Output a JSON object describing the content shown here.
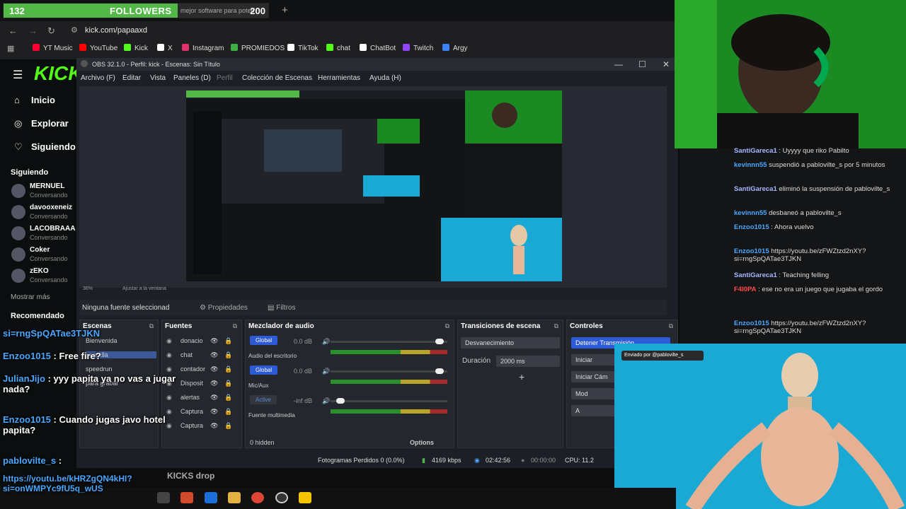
{
  "overlay": {
    "followers_count": "132",
    "followers_label": "FOLLOWERS",
    "followers_total": "200",
    "tab_text": "mejor software para poten"
  },
  "browser": {
    "url": "kick.com/papaaxd",
    "bookmarks": [
      {
        "label": "YT Music",
        "color": "#ff0033"
      },
      {
        "label": "YouTube",
        "color": "#ff0000"
      },
      {
        "label": "Kick",
        "color": "#53fc18"
      },
      {
        "label": "X",
        "color": "#ffffff"
      },
      {
        "label": "Instagram",
        "color": "#e1306c"
      },
      {
        "label": "PROMIEDOS",
        "color": "#3cb043"
      },
      {
        "label": "TikTok",
        "color": "#ffffff"
      },
      {
        "label": "chat",
        "color": "#53fc18"
      },
      {
        "label": "ChatBot",
        "color": "#ffffff"
      },
      {
        "label": "Twitch",
        "color": "#9146ff"
      },
      {
        "label": "Argy",
        "color": "#3b82f6"
      }
    ]
  },
  "kick": {
    "logo": "KICK",
    "nav": [
      "Inicio",
      "Explorar",
      "Siguiendo"
    ],
    "following_title": "Siguiendo",
    "following": [
      {
        "name": "MERNUEL",
        "status": "Conversando"
      },
      {
        "name": "davooxeneiz",
        "status": "Conversando"
      },
      {
        "name": "LACOBRAAA",
        "status": "Conversando"
      },
      {
        "name": "Coker",
        "status": "Conversando"
      },
      {
        "name": "zEKO",
        "status": "Conversando"
      }
    ],
    "show_more": "Mostrar más",
    "recommended_title": "Recomendado",
    "kicks_drop": "KICKS drop"
  },
  "obs": {
    "title": "OBS 32.1.0 - Perfil: kick - Escenas: Sin Título",
    "menu": [
      "Archivo (F)",
      "Editar",
      "Vista",
      "Paneles (D)",
      "Perfil",
      "Colección de Escenas",
      "Herramientas",
      "Ayuda (H)"
    ],
    "zoom": "36%",
    "zoom_label": "Ajustar a la ventana",
    "no_source": "Ninguna fuente seleccionad",
    "properties": "Propiedades",
    "filters": "Filtros",
    "scenes_title": "Escenas",
    "scenes": [
      "Bienvenida",
      "pantalla",
      "speedrun",
      "para grabar"
    ],
    "sources_title": "Fuentes",
    "sources": [
      "donacio",
      "chat",
      "contador",
      "Disposit",
      "alertas",
      "Captura",
      "Captura"
    ],
    "mixer_title": "Mezclador de audio",
    "mixer": [
      {
        "tag": "Global",
        "name": "Audio del escritorio",
        "db": "0.0 dB"
      },
      {
        "tag": "Global",
        "name": "Mic/Aux",
        "db": "0.0 dB"
      },
      {
        "tag": "Active",
        "name": "Fuente multimedia",
        "db": "-inf dB"
      }
    ],
    "hidden": "0 hidden",
    "options": "Options",
    "transitions_title": "Transiciones de escena",
    "transition": "Desvanecimiento",
    "duration_label": "Duración",
    "duration": "2000 ms",
    "controls_title": "Controles",
    "controls": [
      "Detener Transmisión",
      "Iniciar",
      "Iniciar Cám",
      "Mod",
      "A"
    ],
    "status": {
      "dropped": "Fotogramas Perdidos 0 (0.0%)",
      "bitrate": "4169 kbps",
      "live_time": "02:42:56",
      "rec_time": "00:00:00",
      "cpu": "CPU: 11.2"
    }
  },
  "right_chat": [
    {
      "user": "SantiGareca1",
      "text": ": Uyyyy que riko Pabilto"
    },
    {
      "user": "kevinnn55",
      "text": "suspendió a pablovilte_s por 5 minutos"
    },
    {
      "user": "SantiGareca1",
      "text": "eliminó la suspensión de pablovilte_s"
    },
    {
      "user": "kevinnn55",
      "text": "desbaneó a pablovilte_s"
    },
    {
      "user": "Enzoo1015",
      "text": ": Ahora vuelvo"
    },
    {
      "user": "Enzoo1015",
      "text": "https://youtu.be/zFWZtzd2nXY?si=rngSpQATae3TJKN"
    },
    {
      "user": "SantiGareca1",
      "text": ": Teaching felling"
    },
    {
      "user": "F4I0PA",
      "text": ": ese no era un juego que jugaba el gordo"
    },
    {
      "user": "Enzoo1015",
      "text": "https://youtu.be/zFWZtzd2nXY?si=rngSpQATae3TJKN"
    }
  ],
  "overlay_chat": [
    {
      "user": "",
      "text": "si=rngSpQATae3TJKN"
    },
    {
      "user": "Enzoo1015",
      "text": ": Free fire?"
    },
    {
      "user": "JulianJijo",
      "text": ": yyy papita ya no vas a jugar nada?"
    },
    {
      "user": "Enzoo1015",
      "text": ": Cuando jugas javo hotel papita?"
    },
    {
      "user": "pablovilte_s",
      "text": ":"
    },
    {
      "user": "",
      "text": "https://youtu.be/kHRZgQN4kHI?si=onWMPYc9fU5q_wUS"
    }
  ],
  "donation_label": "Enviado por @pablovilte_s",
  "colors": {
    "kick_green": "#53fc18",
    "obs_bg": "#1d1f26",
    "skeleton_bg": "#1aa8d4",
    "followers_bar": "#53b847"
  }
}
